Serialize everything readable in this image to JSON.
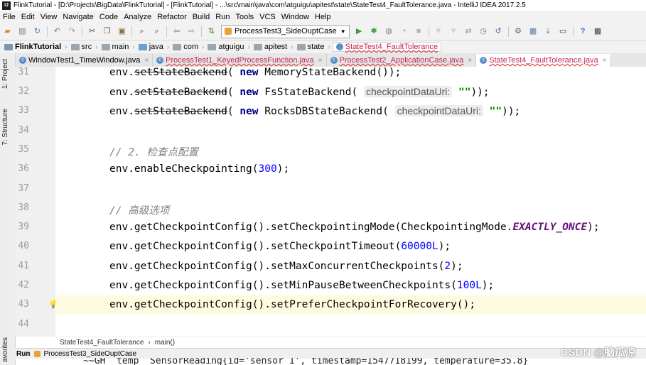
{
  "title_bar": {
    "text": "FlinkTutorial - [D:\\Projects\\BigData\\FlinkTutorial] - [FlinkTutorial] - ...\\src\\main\\java\\com\\atguigu\\apitest\\state\\StateTest4_FaultTolerance.java - IntelliJ IDEA 2017.2.5"
  },
  "menu": [
    "File",
    "Edit",
    "View",
    "Navigate",
    "Code",
    "Analyze",
    "Refactor",
    "Build",
    "Run",
    "Tools",
    "VCS",
    "Window",
    "Help"
  ],
  "toolbar": {
    "run_config": "ProcessTest3_SideOuptCase"
  },
  "breadcrumbs": [
    "FlinkTutorial",
    "src",
    "main",
    "java",
    "com",
    "atguigu",
    "apitest",
    "state",
    "StateTest4_FaultTolerance"
  ],
  "tabs": [
    {
      "label": "WindowTest1_TimeWindow.java",
      "error": false,
      "active": false
    },
    {
      "label": "ProcessTest1_KeyedProcessFunction.java",
      "error": true,
      "active": false
    },
    {
      "label": "ProcessTest2_ApplicationCase.java",
      "error": true,
      "active": false
    },
    {
      "label": "StateTest4_FaultTolerance.java",
      "error": true,
      "active": true
    }
  ],
  "tool_windows": {
    "project": "1: Project",
    "structure": "7: Structure",
    "favorites": "avorites"
  },
  "line_numbers": [
    "31",
    "32",
    "33",
    "34",
    "35",
    "36",
    "37",
    "38",
    "39",
    "40",
    "41",
    "42",
    "43",
    "44"
  ],
  "code": {
    "l31_a": "env.",
    "l31_b": "setStateBackend",
    "l31_c": "( ",
    "l31_kw": "new",
    "l31_d": " MemoryStateBackend());",
    "l32_a": "env.",
    "l32_b": "setStateBackend",
    "l32_c": "( ",
    "l32_kw": "new",
    "l32_d": " FsStateBackend( ",
    "l32_hint": "checkpointDataUri:",
    "l32_str": " \"\"",
    "l32_e": "));",
    "l33_a": "env.",
    "l33_b": "setStateBackend",
    "l33_c": "( ",
    "l33_kw": "new",
    "l33_d": " RocksDBStateBackend( ",
    "l33_hint": "checkpointDataUri:",
    "l33_str": " \"\"",
    "l33_e": "));",
    "l35": "// 2. 检查点配置",
    "l36_a": "env.enableCheckpointing(",
    "l36_num": "300",
    "l36_b": ");",
    "l38": "// 高级选项",
    "l39_a": "env.getCheckpointConfig().setCheckpointingMode(CheckpointingMode.",
    "l39_const": "EXACTLY_ONCE",
    "l39_b": ");",
    "l40_a": "env.getCheckpointConfig().setCheckpointTimeout(",
    "l40_num": "60000L",
    "l40_b": ");",
    "l41_a": "env.getCheckpointConfig().setMaxConcurrentCheckpoints(",
    "l41_num": "2",
    "l41_b": ");",
    "l42_a": "env.getCheckpointConfig().setMinPauseBetweenCheckpoints(",
    "l42_num": "100L",
    "l42_b": ");",
    "l43": "env.getCheckpointConfig().setPreferCheckpointForRecovery();"
  },
  "footer_breadcrumb": {
    "class_name": "StateTest4_FaultTolerance",
    "sep": "›",
    "method": "main()"
  },
  "run_bar": {
    "label": "Run",
    "config": "ProcessTest3_SideOuptCase"
  },
  "console_peek": "     ~~GH  temp  SensorReading{id='sensor_1', timestamp=1547718199, temperature=35.8}",
  "watermark": "CSDN @脑瓜凉"
}
